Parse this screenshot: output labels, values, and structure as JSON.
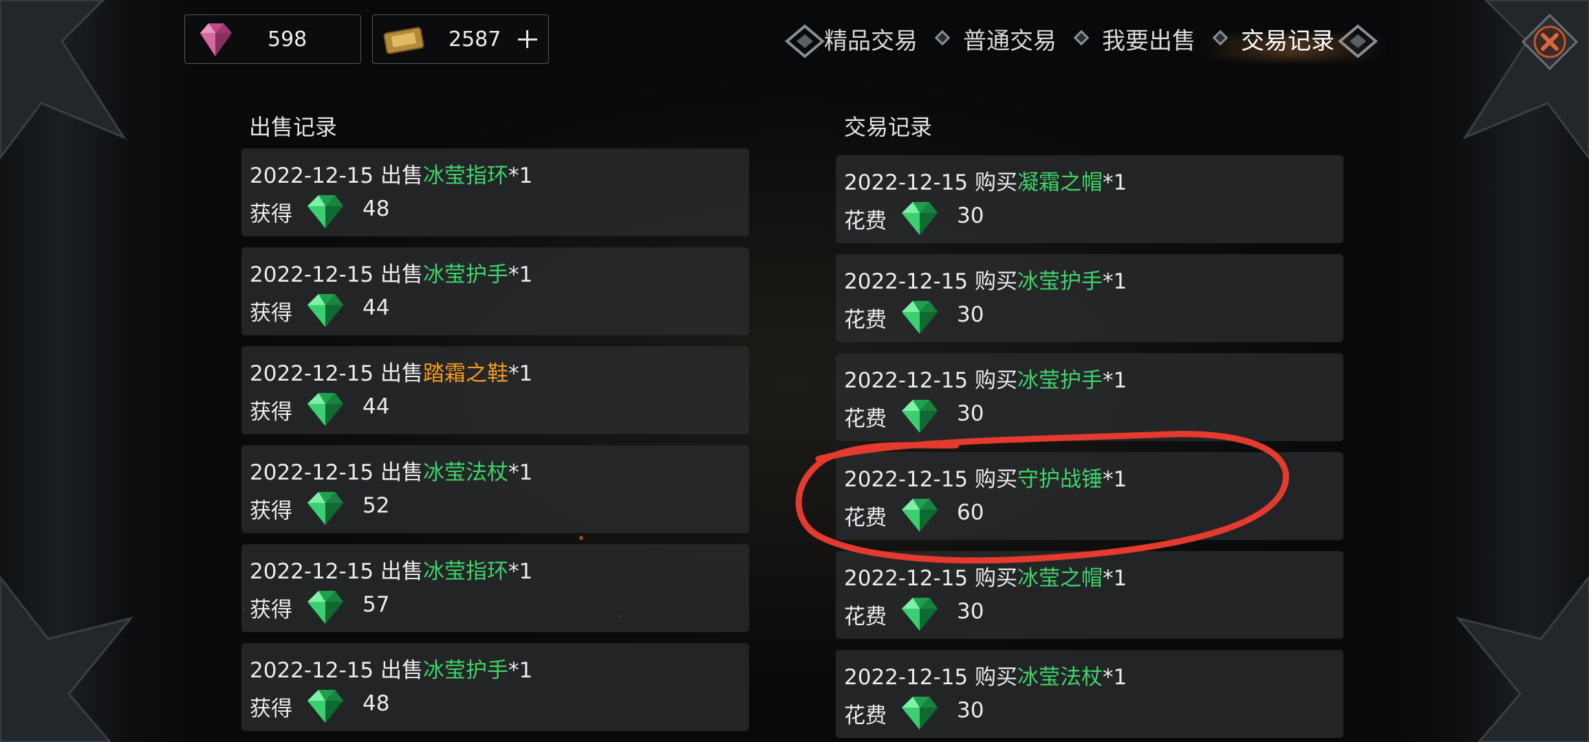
{
  "currency": {
    "gem_count": "598",
    "ticket_count": "2587"
  },
  "tabs": [
    {
      "label": "精品交易"
    },
    {
      "label": "普通交易"
    },
    {
      "label": "我要出售"
    },
    {
      "label": "交易记录"
    }
  ],
  "active_tab": "交易记录",
  "sales": {
    "title": "出售记录",
    "gain_label": "获得",
    "records": [
      {
        "date": "2022-12-15",
        "action": "出售",
        "item": "冰莹指环",
        "qty": "*1",
        "amount": "48",
        "item_color": "#3fd36a"
      },
      {
        "date": "2022-12-15",
        "action": "出售",
        "item": "冰莹护手",
        "qty": "*1",
        "amount": "44",
        "item_color": "#3fd36a"
      },
      {
        "date": "2022-12-15",
        "action": "出售",
        "item": "踏霜之鞋",
        "qty": "*1",
        "amount": "44",
        "item_color": "#f39a23"
      },
      {
        "date": "2022-12-15",
        "action": "出售",
        "item": "冰莹法杖",
        "qty": "*1",
        "amount": "52",
        "item_color": "#3fd36a"
      },
      {
        "date": "2022-12-15",
        "action": "出售",
        "item": "冰莹指环",
        "qty": "*1",
        "amount": "57",
        "item_color": "#3fd36a"
      },
      {
        "date": "2022-12-15",
        "action": "出售",
        "item": "冰莹护手",
        "qty": "*1",
        "amount": "48",
        "item_color": "#3fd36a"
      }
    ]
  },
  "trades": {
    "title": "交易记录",
    "cost_label": "花费",
    "records": [
      {
        "date": "2022-12-15",
        "action": "购买",
        "item": "凝霜之帽",
        "qty": "*1",
        "amount": "30",
        "item_color": "#3fd36a"
      },
      {
        "date": "2022-12-15",
        "action": "购买",
        "item": "冰莹护手",
        "qty": "*1",
        "amount": "30",
        "item_color": "#3fd36a"
      },
      {
        "date": "2022-12-15",
        "action": "购买",
        "item": "冰莹护手",
        "qty": "*1",
        "amount": "30",
        "item_color": "#3fd36a"
      },
      {
        "date": "2022-12-15",
        "action": "购买",
        "item": "守护战锤",
        "qty": "*1",
        "amount": "60",
        "item_color": "#3fd36a"
      },
      {
        "date": "2022-12-15",
        "action": "购买",
        "item": "冰莹之帽",
        "qty": "*1",
        "amount": "30",
        "item_color": "#3fd36a"
      },
      {
        "date": "2022-12-15",
        "action": "购买",
        "item": "冰莹法杖",
        "qty": "*1",
        "amount": "30",
        "item_color": "#3fd36a"
      }
    ]
  },
  "colors": {
    "highlight_circle": "#e53a2e",
    "green_item": "#3fd36a",
    "orange_item": "#f39a23"
  }
}
